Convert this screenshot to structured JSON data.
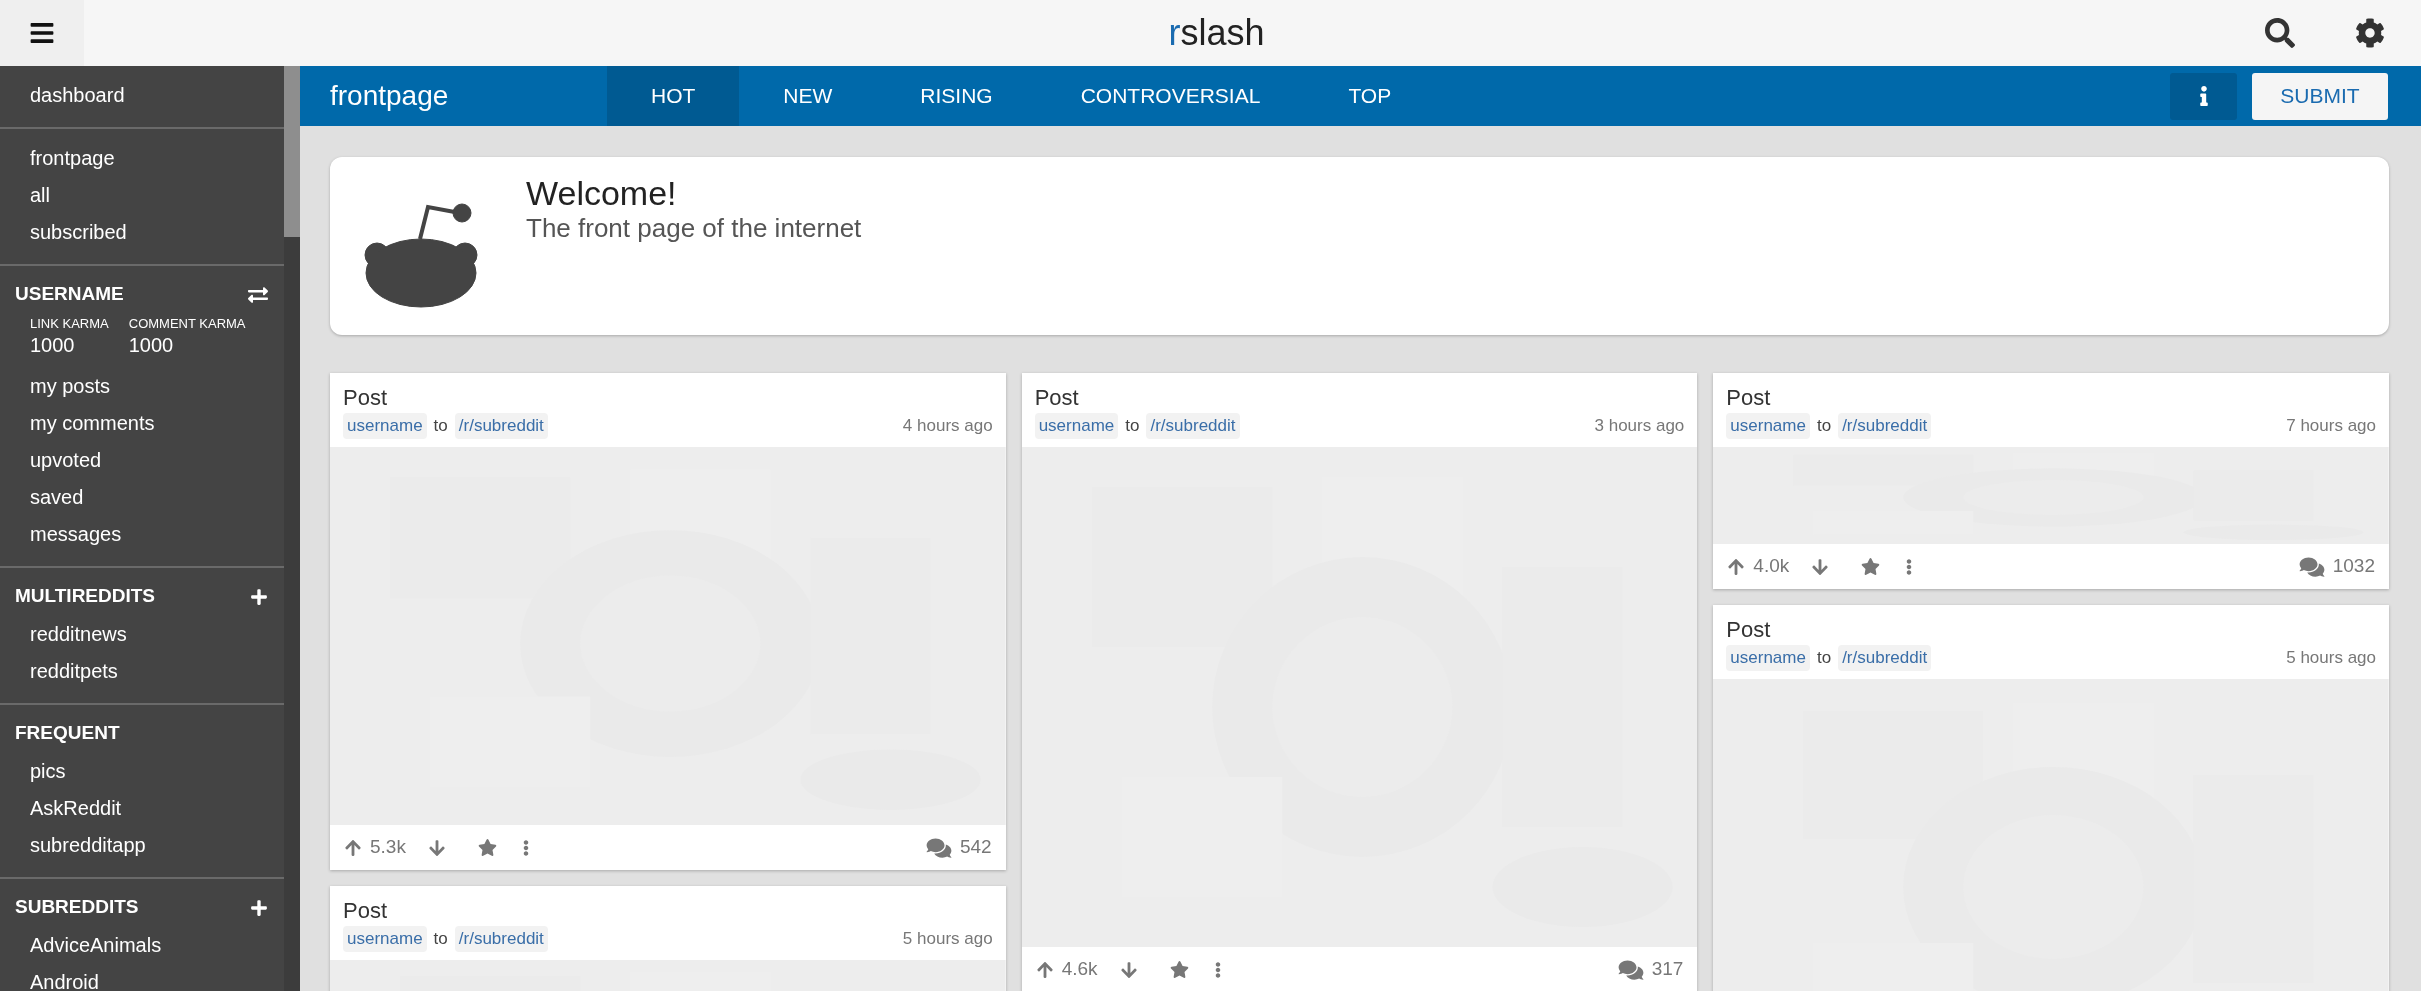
{
  "topbar": {
    "logo_accent": "r",
    "logo_rest": "slash"
  },
  "sidebar": {
    "sections": [
      {
        "items": [
          "dashboard"
        ]
      },
      {
        "items": [
          "frontpage",
          "all",
          "subscribed"
        ]
      },
      {
        "kind": "user",
        "title": "USERNAME",
        "stats": [
          {
            "label": "LINK KARMA",
            "value": "1000"
          },
          {
            "label": "COMMENT KARMA",
            "value": "1000"
          }
        ],
        "items": [
          "my posts",
          "my comments",
          "upvoted",
          "saved",
          "messages"
        ]
      },
      {
        "kind": "group",
        "title": "MULTIREDDITS",
        "items": [
          "redditnews",
          "redditpets"
        ]
      },
      {
        "kind": "plain",
        "title": "FREQUENT",
        "items": [
          "pics",
          "AskReddit",
          "subredditapp"
        ]
      },
      {
        "kind": "group",
        "title": "SUBREDDITS",
        "items": [
          "AdviceAnimals",
          "Android"
        ]
      }
    ]
  },
  "subheader": {
    "title": "frontpage",
    "tabs": [
      {
        "label": "HOT",
        "selected": true
      },
      {
        "label": "NEW",
        "selected": false
      },
      {
        "label": "RISING",
        "selected": false
      },
      {
        "label": "CONTROVERSIAL",
        "selected": false
      },
      {
        "label": "TOP",
        "selected": false
      }
    ],
    "submit": "SUBMIT"
  },
  "welcome": {
    "title": "Welcome!",
    "subtitle": "The front page of the internet"
  },
  "columns": [
    {
      "posts": [
        {
          "title": "Post",
          "author": "username",
          "connector": "to",
          "subreddit": "/r/subreddit",
          "time": "4 hours ago",
          "votes": "5.3k",
          "comments": "542"
        },
        {
          "title": "Post",
          "author": "username",
          "connector": "to",
          "subreddit": "/r/subreddit",
          "time": "5 hours ago"
        }
      ]
    },
    {
      "posts": [
        {
          "title": "Post",
          "author": "username",
          "connector": "to",
          "subreddit": "/r/subreddit",
          "time": "3 hours ago",
          "votes": "4.6k",
          "comments": "317"
        }
      ]
    },
    {
      "posts": [
        {
          "title": "Post",
          "author": "username",
          "connector": "to",
          "subreddit": "/r/subreddit",
          "time": "7 hours ago",
          "votes": "4.0k",
          "comments": "1032"
        },
        {
          "title": "Post",
          "author": "username",
          "connector": "to",
          "subreddit": "/r/subreddit",
          "time": "5 hours ago"
        }
      ]
    }
  ]
}
